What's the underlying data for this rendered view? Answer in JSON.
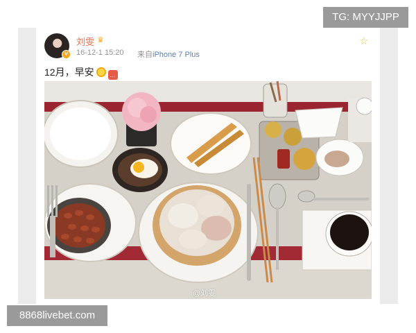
{
  "post": {
    "user_name": "刘雯",
    "timestamp": "16-12-1 15:20",
    "device_prefix": "来自",
    "device_name": "iPhone 7 Plus",
    "text": "12月，早安",
    "photo_watermark": "@刘雯"
  },
  "overlays": {
    "top_right": "TG: MYYJJPP",
    "bottom_left": "8868livebet.com"
  },
  "icons": {
    "verified": "verified-badge-icon",
    "crown": "crown-icon",
    "favorite": "star-icon",
    "emoji_1": "sun-emoji-icon",
    "emoji_2": "chat-emoji-icon"
  }
}
